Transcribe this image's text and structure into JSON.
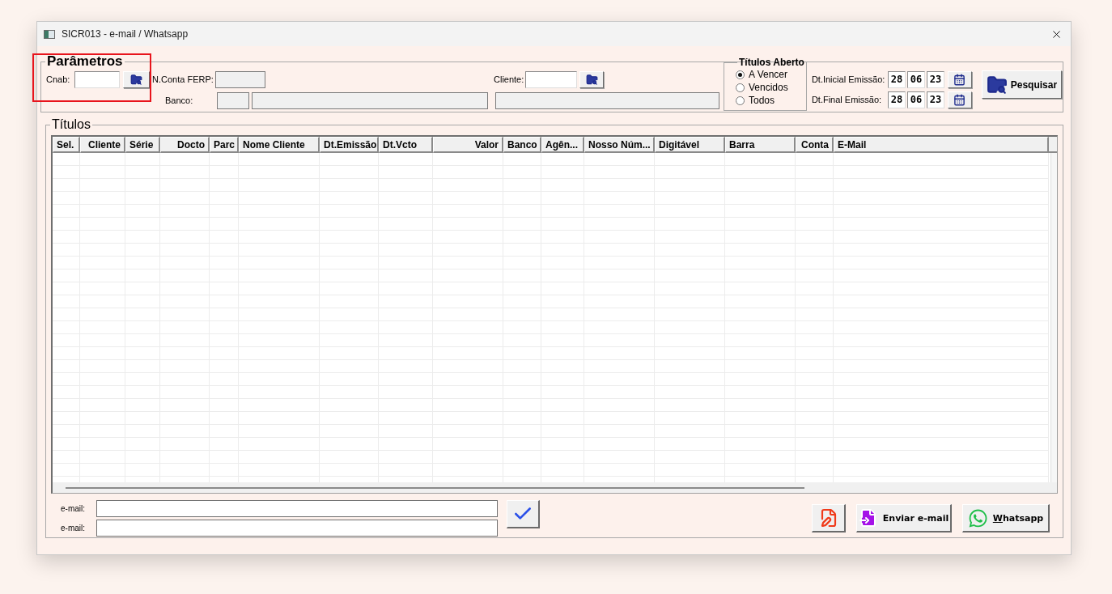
{
  "window": {
    "title": "SICR013 - e-mail / Whatsapp"
  },
  "parametros": {
    "legend": "Parâmetros",
    "highlighted": true,
    "cnab": {
      "label": "Cnab:",
      "disabled": false
    },
    "conta_ferp": {
      "label": "N.Conta FERP:",
      "disabled": true
    },
    "banco": {
      "label": "Banco:",
      "disabled": true
    },
    "cliente": {
      "label": "Cliente:",
      "disabled": false
    },
    "titulos_aberto": {
      "legend": "Títulos Aberto",
      "options": [
        {
          "label": "A Vencer",
          "selected": true
        },
        {
          "label": "Vencidos",
          "selected": false
        },
        {
          "label": "Todos",
          "selected": false
        }
      ]
    },
    "dates": [
      {
        "label": "Dt.Inicial Emissão:",
        "day": "28",
        "month": "06",
        "year": "23"
      },
      {
        "label": "Dt.Final Emissão:",
        "day": "28",
        "month": "06",
        "year": "23"
      }
    ],
    "search_button": "Pesquisar"
  },
  "titulos": {
    "legend": "Títulos",
    "columns": [
      {
        "label": "Sel."
      },
      {
        "label": "Cliente"
      },
      {
        "label": "Série"
      },
      {
        "label": "Docto"
      },
      {
        "label": "Parc"
      },
      {
        "label": "Nome Cliente"
      },
      {
        "label": "Dt.Emissão"
      },
      {
        "label": "Dt.Vcto"
      },
      {
        "label": "Valor"
      },
      {
        "label": "Banco"
      },
      {
        "label": "Agên..."
      },
      {
        "label": "Nosso Núm..."
      },
      {
        "label": "Digitável"
      },
      {
        "label": "Barra"
      },
      {
        "label": "Conta"
      },
      {
        "label": "E-Mail"
      }
    ]
  },
  "email_fields": [
    {
      "label": "e-mail:"
    },
    {
      "label": "e-mail:"
    }
  ],
  "buttons": [
    {
      "kind": "edit"
    },
    {
      "kind": "send",
      "label": "Enviar e-mail"
    },
    {
      "kind": "whatsapp",
      "label": "Whatsapp",
      "accelerator": true
    }
  ]
}
